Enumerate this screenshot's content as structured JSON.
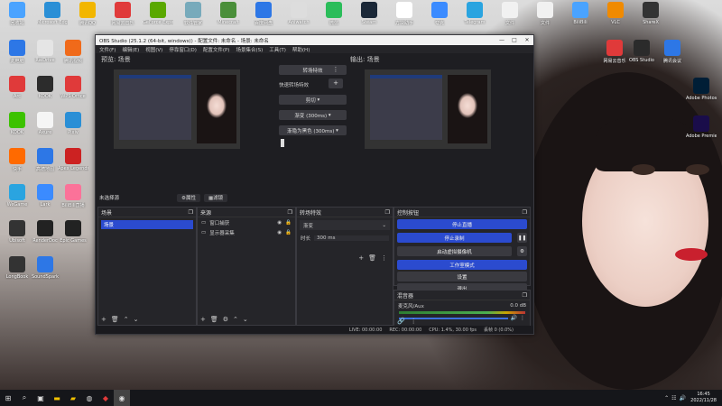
{
  "desktop": {
    "icons_left": [
      {
        "label": "回收站",
        "color": "#4aa3ff"
      },
      {
        "label": "Microsoft Edge",
        "color": "#2a8fd6"
      },
      {
        "label": "腾讯QQ",
        "color": "#f2b600"
      },
      {
        "label": "网易云音乐",
        "color": "#e03a3a"
      },
      {
        "label": "GeForce Experience",
        "color": "#5aa800"
      },
      {
        "label": "软件管家",
        "color": "#7ab"
      },
      {
        "label": "Minecraft",
        "color": "#4a8f3a"
      },
      {
        "label": "百度网盘",
        "color": "#2d77e6"
      },
      {
        "label": "Aniwatch",
        "color": "#ddd"
      },
      {
        "label": "微信",
        "color": "#2bbd5a"
      },
      {
        "label": "Steam",
        "color": "#1b2838"
      },
      {
        "label": "方块助手",
        "color": "#fff"
      },
      {
        "label": "夸克",
        "color": "#3b8bff"
      },
      {
        "label": "Telegram",
        "color": "#2aa4e0"
      },
      {
        "label": "文件",
        "color": "#f1f1f1"
      },
      {
        "label": "文件",
        "color": "#f1f1f1"
      },
      {
        "label": "BiliBili",
        "color": "#4aa3ff"
      },
      {
        "label": "VLC",
        "color": "#f08a00"
      },
      {
        "label": "ShareX",
        "color": "#333"
      }
    ],
    "icons_col": [
      {
        "label": "此电脑",
        "color": "#2d77e6"
      },
      {
        "label": "RaiDrive",
        "color": "#e5e5e5"
      },
      {
        "label": "腾讯视频",
        "color": "#f06a1a"
      },
      {
        "label": "Arc",
        "color": "#e03a3a"
      },
      {
        "label": "KOOK",
        "color": "#2c2c2c"
      },
      {
        "label": "WPS Office",
        "color": "#e03a3a"
      },
      {
        "label": "KOOK",
        "color": "#3cc200"
      },
      {
        "label": "Axure",
        "color": "#f5f5f5"
      },
      {
        "label": "Pixiv",
        "color": "#2a8fd6"
      },
      {
        "label": "快手",
        "color": "#ff6a00"
      },
      {
        "label": "高德地图",
        "color": "#2d77e6"
      },
      {
        "label": "Apex Legends",
        "color": "#c22"
      },
      {
        "label": "WeGame",
        "color": "#2aa4e0"
      },
      {
        "label": "Lark",
        "color": "#3b8bff"
      },
      {
        "label": "BiliBili直播",
        "color": "#fb7299"
      },
      {
        "label": "Ubisoft",
        "color": "#333"
      },
      {
        "label": "RenderDoc",
        "color": "#222"
      },
      {
        "label": "Epic Games",
        "color": "#222"
      },
      {
        "label": "LongBook",
        "color": "#333"
      },
      {
        "label": "SoundSpark",
        "color": "#2d77e6"
      }
    ],
    "icons_right": [
      {
        "label": "Adobe Photoshop",
        "color": "#001e36"
      },
      {
        "label": "Adobe Premiere",
        "color": "#1a0d4a"
      },
      {
        "label": "OBS Studio",
        "color": "#2b2b2b"
      },
      {
        "label": "网易云音乐",
        "color": "#e03a3a"
      },
      {
        "label": "腾讯会议",
        "color": "#2d77e6"
      }
    ]
  },
  "window": {
    "title": "OBS Studio (25.1.2 (64-bit, windows)) - 配置文件: 未命名 - 场景: 未命名",
    "minimize": "—",
    "maximize": "□",
    "close": "✕"
  },
  "menu": [
    "文件(F)",
    "编辑(E)",
    "视图(V)",
    "停靠窗口(D)",
    "配置文件(P)",
    "场景集合(S)",
    "工具(T)",
    "帮助(H)"
  ],
  "studio": {
    "preview_label": "预览: 场景",
    "program_label": "输出: 场景",
    "transition_btn": "转场特效",
    "quick_transitions_label": "快速转场特效",
    "add_btn": "+",
    "more_btn": "⋮",
    "cut_option": "剪切",
    "fade_option": "渐变 (300ms)",
    "stinger_option": "渐隐为黑色 (300ms)"
  },
  "filter_bar": {
    "label": "未选择源",
    "props_btn": "⚙属性",
    "filters_btn": "▦滤镜"
  },
  "scenes": {
    "header": "场景",
    "items": [
      "场景"
    ]
  },
  "sources": {
    "header": "来源",
    "items": [
      "窗口捕获",
      "显示器采集"
    ]
  },
  "transitions": {
    "header": "转场特效",
    "selected": "渐变",
    "duration_label": "时长",
    "duration_value": "300 ms"
  },
  "controls": {
    "header": "控制按钮",
    "stop_stream": "停止直播",
    "stop_record": "停止录制",
    "virtual_cam": "启动虚拟摄像机",
    "studio_mode": "工作室模式",
    "settings": "设置",
    "exit": "退出"
  },
  "mixer": {
    "header": "混音器",
    "track_name": "麦克风/Aux",
    "level": "0.0 dB"
  },
  "status": {
    "live": "LIVE: 00:00:00",
    "rec": "REC: 00:00:00",
    "cpu": "CPU: 1.4%, 30.00 fps",
    "dropped": "丢帧 0 (0.0%)"
  },
  "taskbar": {
    "time": "16:45",
    "date": "2022/11/28"
  }
}
